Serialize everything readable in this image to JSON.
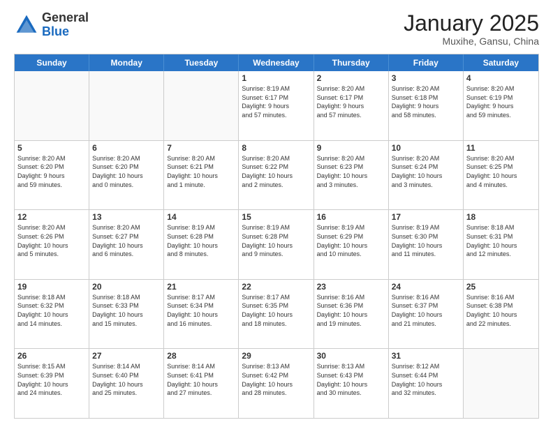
{
  "header": {
    "logo_general": "General",
    "logo_blue": "Blue",
    "title": "January 2025",
    "subtitle": "Muxihe, Gansu, China"
  },
  "days_of_week": [
    "Sunday",
    "Monday",
    "Tuesday",
    "Wednesday",
    "Thursday",
    "Friday",
    "Saturday"
  ],
  "weeks": [
    [
      {
        "day": "",
        "info": ""
      },
      {
        "day": "",
        "info": ""
      },
      {
        "day": "",
        "info": ""
      },
      {
        "day": "1",
        "info": "Sunrise: 8:19 AM\nSunset: 6:17 PM\nDaylight: 9 hours\nand 57 minutes."
      },
      {
        "day": "2",
        "info": "Sunrise: 8:20 AM\nSunset: 6:17 PM\nDaylight: 9 hours\nand 57 minutes."
      },
      {
        "day": "3",
        "info": "Sunrise: 8:20 AM\nSunset: 6:18 PM\nDaylight: 9 hours\nand 58 minutes."
      },
      {
        "day": "4",
        "info": "Sunrise: 8:20 AM\nSunset: 6:19 PM\nDaylight: 9 hours\nand 59 minutes."
      }
    ],
    [
      {
        "day": "5",
        "info": "Sunrise: 8:20 AM\nSunset: 6:20 PM\nDaylight: 9 hours\nand 59 minutes."
      },
      {
        "day": "6",
        "info": "Sunrise: 8:20 AM\nSunset: 6:20 PM\nDaylight: 10 hours\nand 0 minutes."
      },
      {
        "day": "7",
        "info": "Sunrise: 8:20 AM\nSunset: 6:21 PM\nDaylight: 10 hours\nand 1 minute."
      },
      {
        "day": "8",
        "info": "Sunrise: 8:20 AM\nSunset: 6:22 PM\nDaylight: 10 hours\nand 2 minutes."
      },
      {
        "day": "9",
        "info": "Sunrise: 8:20 AM\nSunset: 6:23 PM\nDaylight: 10 hours\nand 3 minutes."
      },
      {
        "day": "10",
        "info": "Sunrise: 8:20 AM\nSunset: 6:24 PM\nDaylight: 10 hours\nand 3 minutes."
      },
      {
        "day": "11",
        "info": "Sunrise: 8:20 AM\nSunset: 6:25 PM\nDaylight: 10 hours\nand 4 minutes."
      }
    ],
    [
      {
        "day": "12",
        "info": "Sunrise: 8:20 AM\nSunset: 6:26 PM\nDaylight: 10 hours\nand 5 minutes."
      },
      {
        "day": "13",
        "info": "Sunrise: 8:20 AM\nSunset: 6:27 PM\nDaylight: 10 hours\nand 6 minutes."
      },
      {
        "day": "14",
        "info": "Sunrise: 8:19 AM\nSunset: 6:28 PM\nDaylight: 10 hours\nand 8 minutes."
      },
      {
        "day": "15",
        "info": "Sunrise: 8:19 AM\nSunset: 6:28 PM\nDaylight: 10 hours\nand 9 minutes."
      },
      {
        "day": "16",
        "info": "Sunrise: 8:19 AM\nSunset: 6:29 PM\nDaylight: 10 hours\nand 10 minutes."
      },
      {
        "day": "17",
        "info": "Sunrise: 8:19 AM\nSunset: 6:30 PM\nDaylight: 10 hours\nand 11 minutes."
      },
      {
        "day": "18",
        "info": "Sunrise: 8:18 AM\nSunset: 6:31 PM\nDaylight: 10 hours\nand 12 minutes."
      }
    ],
    [
      {
        "day": "19",
        "info": "Sunrise: 8:18 AM\nSunset: 6:32 PM\nDaylight: 10 hours\nand 14 minutes."
      },
      {
        "day": "20",
        "info": "Sunrise: 8:18 AM\nSunset: 6:33 PM\nDaylight: 10 hours\nand 15 minutes."
      },
      {
        "day": "21",
        "info": "Sunrise: 8:17 AM\nSunset: 6:34 PM\nDaylight: 10 hours\nand 16 minutes."
      },
      {
        "day": "22",
        "info": "Sunrise: 8:17 AM\nSunset: 6:35 PM\nDaylight: 10 hours\nand 18 minutes."
      },
      {
        "day": "23",
        "info": "Sunrise: 8:16 AM\nSunset: 6:36 PM\nDaylight: 10 hours\nand 19 minutes."
      },
      {
        "day": "24",
        "info": "Sunrise: 8:16 AM\nSunset: 6:37 PM\nDaylight: 10 hours\nand 21 minutes."
      },
      {
        "day": "25",
        "info": "Sunrise: 8:16 AM\nSunset: 6:38 PM\nDaylight: 10 hours\nand 22 minutes."
      }
    ],
    [
      {
        "day": "26",
        "info": "Sunrise: 8:15 AM\nSunset: 6:39 PM\nDaylight: 10 hours\nand 24 minutes."
      },
      {
        "day": "27",
        "info": "Sunrise: 8:14 AM\nSunset: 6:40 PM\nDaylight: 10 hours\nand 25 minutes."
      },
      {
        "day": "28",
        "info": "Sunrise: 8:14 AM\nSunset: 6:41 PM\nDaylight: 10 hours\nand 27 minutes."
      },
      {
        "day": "29",
        "info": "Sunrise: 8:13 AM\nSunset: 6:42 PM\nDaylight: 10 hours\nand 28 minutes."
      },
      {
        "day": "30",
        "info": "Sunrise: 8:13 AM\nSunset: 6:43 PM\nDaylight: 10 hours\nand 30 minutes."
      },
      {
        "day": "31",
        "info": "Sunrise: 8:12 AM\nSunset: 6:44 PM\nDaylight: 10 hours\nand 32 minutes."
      },
      {
        "day": "",
        "info": ""
      }
    ]
  ]
}
